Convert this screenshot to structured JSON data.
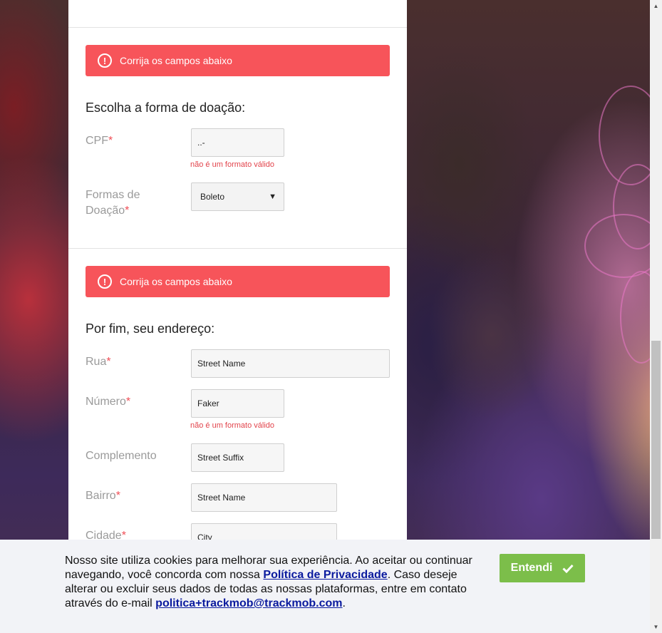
{
  "alerts": {
    "alert1": "Corrija os campos abaixo",
    "alert2": "Corrija os campos abaixo",
    "icon": "exclamation-circle-icon"
  },
  "donation": {
    "title": "Escolha a forma de doação:",
    "cpf_label": "CPF",
    "cpf_value": "..-",
    "cpf_error": "não é um formato válido",
    "forms_label_line1": "Formas de",
    "forms_label_line2": "Doação",
    "forms_selected": "Boleto"
  },
  "address": {
    "title": "Por fim, seu endereço:",
    "street_label": "Rua",
    "street_value": "Street Name",
    "number_label": "Número",
    "number_value": "Faker",
    "number_error": "não é um formato válido",
    "complement_label": "Complemento",
    "complement_value": "Street Suffix",
    "district_label": "Bairro",
    "district_value": "Street Name",
    "city_label": "Cidade",
    "city_value": "City"
  },
  "required_mark": "*",
  "cookie": {
    "text_part1": "Nosso site utiliza cookies para melhorar sua experiência. Ao aceitar ou continuar navegando, você concorda com nossa ",
    "privacy_link": "Política de Privacidade",
    "text_part2": ". Caso deseje alterar ou excluir seus dados de todas as nossas plataformas, entre em contato através do e-mail ",
    "email_link": "politica+trackmob@trackmob.com",
    "text_part3": ".",
    "accept_label": "Entendi"
  },
  "colors": {
    "alert": "#f7545a",
    "required": "#f04e56",
    "accept_button": "#7cbe4a",
    "link": "#0a1a9e"
  }
}
